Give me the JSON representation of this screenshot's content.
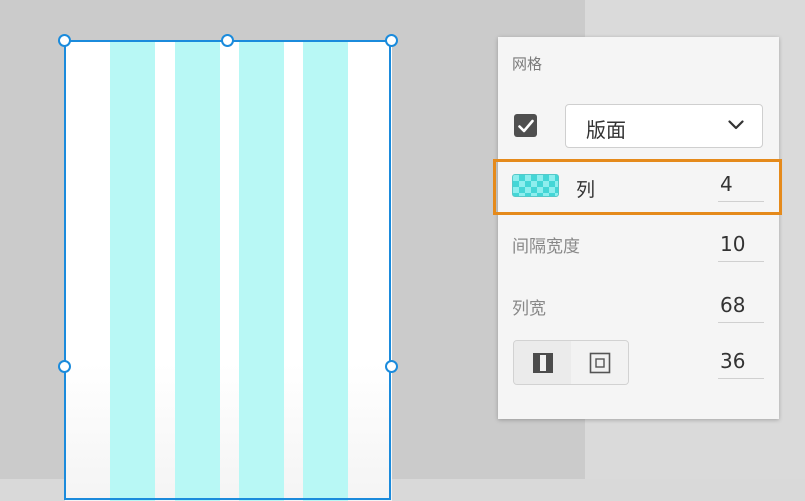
{
  "panel": {
    "title": "网格",
    "layout_enabled": true,
    "layout_select": {
      "selected": "版面"
    },
    "columns": {
      "label": "列",
      "value": "4"
    },
    "gutter_width": {
      "label": "间隔宽度",
      "value": "10"
    },
    "column_width": {
      "label": "列宽",
      "value": "68"
    },
    "margin": {
      "value": "36"
    }
  },
  "artboard": {
    "grid_columns": 4
  },
  "colors": {
    "selection": "#1b8bdc",
    "grid_column": "#b8f8f5",
    "highlight": "#e58a1b"
  }
}
